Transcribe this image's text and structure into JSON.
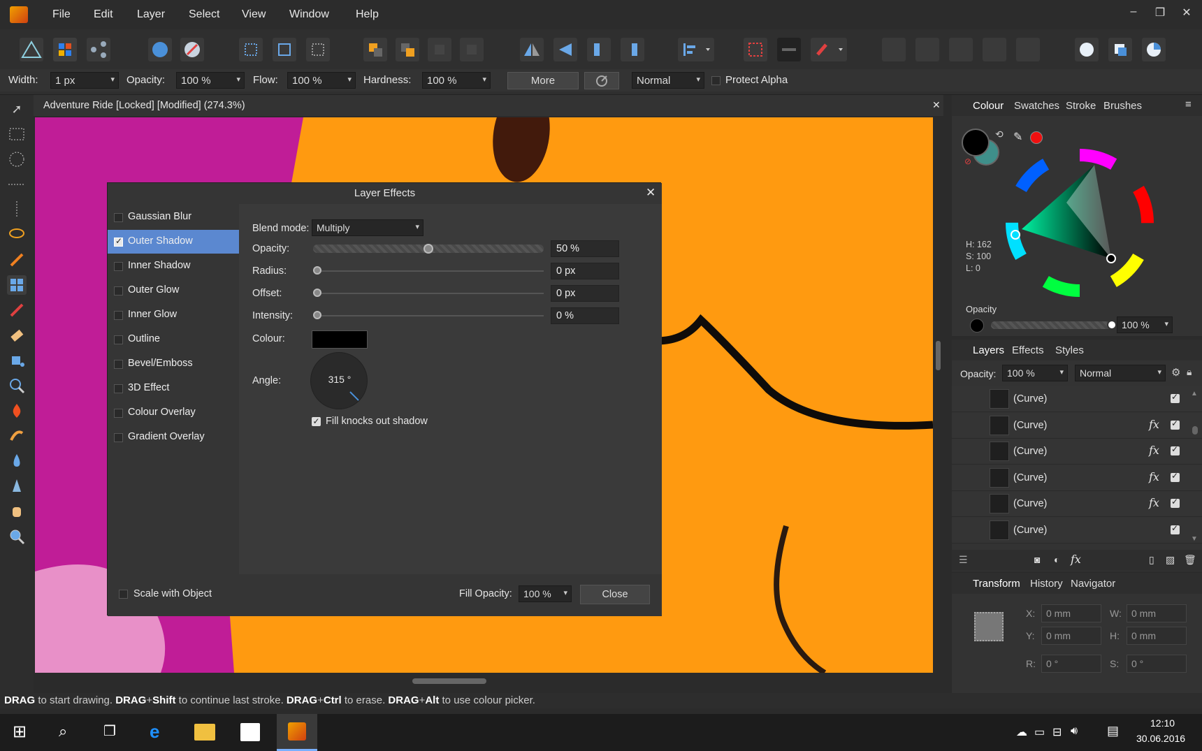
{
  "menubar": {
    "items": [
      "File",
      "Edit",
      "Layer",
      "Select",
      "View",
      "Window",
      "Help"
    ],
    "window_controls": {
      "minimize": "–",
      "restore": "❐",
      "close": "✕"
    }
  },
  "context_bar": {
    "width_label": "Width:",
    "width_value": "1 px",
    "opacity_label": "Opacity:",
    "opacity_value": "100 %",
    "flow_label": "Flow:",
    "flow_value": "100 %",
    "hardness_label": "Hardness:",
    "hardness_value": "100 %",
    "more_label": "More",
    "blend_value": "Normal",
    "protect_alpha": "Protect Alpha"
  },
  "document": {
    "title": "Adventure Ride [Locked] [Modified] (274.3%)"
  },
  "dialog": {
    "title": "Layer Effects",
    "effects": [
      {
        "label": "Gaussian Blur",
        "checked": false
      },
      {
        "label": "Outer Shadow",
        "checked": true
      },
      {
        "label": "Inner Shadow",
        "checked": false
      },
      {
        "label": "Outer Glow",
        "checked": false
      },
      {
        "label": "Inner Glow",
        "checked": false
      },
      {
        "label": "Outline",
        "checked": false
      },
      {
        "label": "Bevel/Emboss",
        "checked": false
      },
      {
        "label": "3D Effect",
        "checked": false
      },
      {
        "label": "Colour Overlay",
        "checked": false
      },
      {
        "label": "Gradient Overlay",
        "checked": false
      }
    ],
    "blend_mode_label": "Blend mode:",
    "blend_mode_value": "Multiply",
    "opacity_label": "Opacity:",
    "opacity_value": "50 %",
    "opacity_fraction": 0.5,
    "radius_label": "Radius:",
    "radius_value": "0 px",
    "offset_label": "Offset:",
    "offset_value": "0 px",
    "intensity_label": "Intensity:",
    "intensity_value": "0 %",
    "colour_label": "Colour:",
    "colour_swatch": "#000000",
    "angle_label": "Angle:",
    "angle_value": "315 °",
    "fill_knocks_label": "Fill knocks out shadow",
    "scale_label": "Scale with Object",
    "fill_opacity_label": "Fill Opacity:",
    "fill_opacity_value": "100 %",
    "close_label": "Close"
  },
  "colour_panel": {
    "tabs": [
      "Colour",
      "Swatches",
      "Stroke",
      "Brushes"
    ],
    "h": "H: 162",
    "s": "S: 100",
    "l": "L: 0",
    "opacity_label": "Opacity",
    "opacity_value": "100 %"
  },
  "layers_panel": {
    "tabs": [
      "Layers",
      "Effects",
      "Styles"
    ],
    "opacity_label": "Opacity:",
    "opacity_value": "100 %",
    "blend_value": "Normal",
    "rows": [
      {
        "name": "(Curve)",
        "fx": false
      },
      {
        "name": "(Curve)",
        "fx": true
      },
      {
        "name": "(Curve)",
        "fx": true
      },
      {
        "name": "(Curve)",
        "fx": true
      },
      {
        "name": "(Curve)",
        "fx": true
      },
      {
        "name": "(Curve)",
        "fx": false
      }
    ],
    "fx_glyph": "fx"
  },
  "transform_panel": {
    "tabs": [
      "Transform",
      "History",
      "Navigator"
    ],
    "x_label": "X:",
    "x_value": "0 mm",
    "w_label": "W:",
    "w_value": "0 mm",
    "y_label": "Y:",
    "y_value": "0 mm",
    "h_label": "H:",
    "h_value": "0 mm",
    "r_label": "R:",
    "r_value": "0 °",
    "s_label": "S:",
    "s_value": "0 °"
  },
  "statusbar": {
    "parts": [
      {
        "t": "DRAG",
        "b": true
      },
      {
        "t": " to start drawing. ",
        "b": false
      },
      {
        "t": "DRAG",
        "b": true
      },
      {
        "t": "+",
        "b": false
      },
      {
        "t": "Shift",
        "b": true
      },
      {
        "t": " to continue last stroke. ",
        "b": false
      },
      {
        "t": "DRAG",
        "b": true
      },
      {
        "t": "+",
        "b": false
      },
      {
        "t": "Ctrl",
        "b": true
      },
      {
        "t": " to erase. ",
        "b": false
      },
      {
        "t": "DRAG",
        "b": true
      },
      {
        "t": "+",
        "b": false
      },
      {
        "t": "Alt",
        "b": true
      },
      {
        "t": " to use colour picker.",
        "b": false
      }
    ]
  },
  "taskbar": {
    "time": "12:10",
    "date": "30.06.2016"
  }
}
